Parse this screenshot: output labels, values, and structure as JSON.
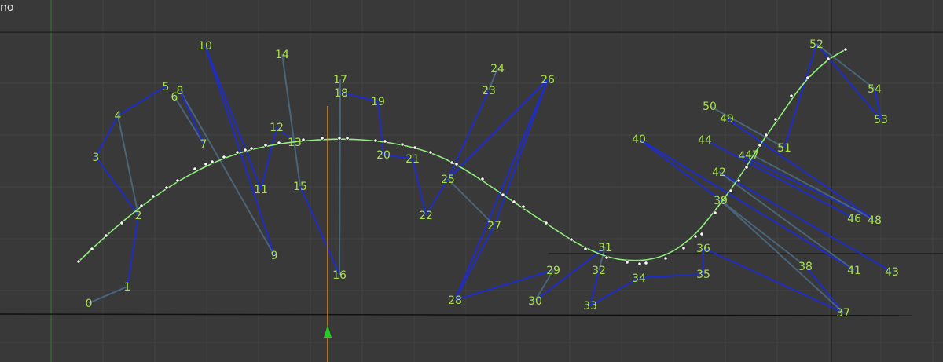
{
  "viewport": {
    "corner_text": "no",
    "colors": {
      "background": "#393939",
      "grid": "#444444",
      "axis_y": "#2e7d2e",
      "frame_line": "#111111",
      "playhead": "#ff9a1e",
      "curve": "#8ef07a",
      "handle_line": "#1f2ccc",
      "handle_line_muted": "#4a6478",
      "label": "#a8e04a",
      "arrow": "#22cc22"
    }
  },
  "points": [
    {
      "id": "0",
      "label": "0"
    },
    {
      "id": "1",
      "label": "1"
    },
    {
      "id": "2",
      "label": "2"
    },
    {
      "id": "3",
      "label": "3"
    },
    {
      "id": "4",
      "label": "4"
    },
    {
      "id": "5",
      "label": "5"
    },
    {
      "id": "6",
      "label": "6"
    },
    {
      "id": "7",
      "label": "7"
    },
    {
      "id": "8",
      "label": "8"
    },
    {
      "id": "9",
      "label": "9"
    },
    {
      "id": "10",
      "label": "10"
    },
    {
      "id": "11",
      "label": "11"
    },
    {
      "id": "12",
      "label": "12"
    },
    {
      "id": "13",
      "label": "13"
    },
    {
      "id": "14",
      "label": "14"
    },
    {
      "id": "15",
      "label": "15"
    },
    {
      "id": "16",
      "label": "16"
    },
    {
      "id": "17",
      "label": "17"
    },
    {
      "id": "18",
      "label": "18"
    },
    {
      "id": "19",
      "label": "19"
    },
    {
      "id": "20",
      "label": "20"
    },
    {
      "id": "21",
      "label": "21"
    },
    {
      "id": "22",
      "label": "22"
    },
    {
      "id": "23",
      "label": "23"
    },
    {
      "id": "24",
      "label": "24"
    },
    {
      "id": "25",
      "label": "25"
    },
    {
      "id": "26",
      "label": "26"
    },
    {
      "id": "27",
      "label": "27"
    },
    {
      "id": "28",
      "label": "28"
    },
    {
      "id": "29",
      "label": "29"
    },
    {
      "id": "30",
      "label": "30"
    },
    {
      "id": "31",
      "label": "31"
    },
    {
      "id": "32",
      "label": "32"
    },
    {
      "id": "33",
      "label": "33"
    },
    {
      "id": "34",
      "label": "34"
    },
    {
      "id": "35",
      "label": "35"
    },
    {
      "id": "36",
      "label": "36"
    },
    {
      "id": "37",
      "label": "37"
    },
    {
      "id": "38",
      "label": "38"
    },
    {
      "id": "39",
      "label": "39"
    },
    {
      "id": "40",
      "label": "40"
    },
    {
      "id": "41",
      "label": "41"
    },
    {
      "id": "42",
      "label": "42"
    },
    {
      "id": "43",
      "label": "43"
    },
    {
      "id": "44",
      "label": "44"
    },
    {
      "id": "45",
      "label": "4"
    },
    {
      "id": "46",
      "label": "46"
    },
    {
      "id": "47",
      "label": "47"
    },
    {
      "id": "48",
      "label": "48"
    },
    {
      "id": "49",
      "label": "49"
    },
    {
      "id": "50",
      "label": "50"
    },
    {
      "id": "51",
      "label": "51"
    },
    {
      "id": "52",
      "label": "52"
    },
    {
      "id": "53",
      "label": "53"
    },
    {
      "id": "54",
      "label": "54"
    }
  ],
  "segments": [
    {
      "a": "0",
      "b": "1",
      "muted": false
    },
    {
      "a": "1",
      "b": "2",
      "muted": false
    },
    {
      "a": "2",
      "b": "3",
      "muted": false
    },
    {
      "a": "3",
      "b": "4",
      "muted": false
    },
    {
      "a": "4",
      "b": "5",
      "muted": false
    },
    {
      "a": "2",
      "b": "4",
      "muted": true
    },
    {
      "a": "1",
      "b": "0",
      "muted": true
    },
    {
      "a": "6",
      "b": "7",
      "muted": true
    },
    {
      "a": "8",
      "b": "9",
      "muted": true
    },
    {
      "a": "8",
      "b": "7",
      "muted": false
    },
    {
      "a": "10",
      "b": "11",
      "muted": false
    },
    {
      "a": "10",
      "b": "9",
      "muted": false
    },
    {
      "a": "11",
      "b": "12",
      "muted": false
    },
    {
      "a": "12",
      "b": "13",
      "muted": false
    },
    {
      "a": "14",
      "b": "15",
      "muted": true
    },
    {
      "a": "15",
      "b": "16",
      "muted": false
    },
    {
      "a": "17",
      "b": "16",
      "muted": true
    },
    {
      "a": "18",
      "b": "19",
      "muted": false
    },
    {
      "a": "19",
      "b": "20",
      "muted": false
    },
    {
      "a": "20",
      "b": "21",
      "muted": false
    },
    {
      "a": "21",
      "b": "22",
      "muted": false
    },
    {
      "a": "22",
      "b": "25",
      "muted": false
    },
    {
      "a": "23",
      "b": "24",
      "muted": true
    },
    {
      "a": "23",
      "b": "25",
      "muted": false
    },
    {
      "a": "25",
      "b": "26",
      "muted": false
    },
    {
      "a": "26",
      "b": "27",
      "muted": false
    },
    {
      "a": "27",
      "b": "28",
      "muted": false
    },
    {
      "a": "26",
      "b": "28",
      "muted": false
    },
    {
      "a": "25",
      "b": "27",
      "muted": true
    },
    {
      "a": "28",
      "b": "29",
      "muted": false
    },
    {
      "a": "29",
      "b": "30",
      "muted": true
    },
    {
      "a": "30",
      "b": "31",
      "muted": false
    },
    {
      "a": "31",
      "b": "32",
      "muted": true
    },
    {
      "a": "32",
      "b": "33",
      "muted": false
    },
    {
      "a": "33",
      "b": "34",
      "muted": false
    },
    {
      "a": "34",
      "b": "35",
      "muted": false
    },
    {
      "a": "35",
      "b": "36",
      "muted": false
    },
    {
      "a": "36",
      "b": "37",
      "muted": false
    },
    {
      "a": "37",
      "b": "38",
      "muted": false
    },
    {
      "a": "37",
      "b": "39",
      "muted": true
    },
    {
      "a": "39",
      "b": "40",
      "muted": false
    },
    {
      "a": "39",
      "b": "38",
      "muted": true
    },
    {
      "a": "40",
      "b": "41",
      "muted": false
    },
    {
      "a": "42",
      "b": "43",
      "muted": false
    },
    {
      "a": "44",
      "b": "46",
      "muted": false
    },
    {
      "a": "45",
      "b": "48",
      "muted": false
    },
    {
      "a": "47",
      "b": "48",
      "muted": true
    },
    {
      "a": "49",
      "b": "48",
      "muted": false
    },
    {
      "a": "50",
      "b": "51",
      "muted": true
    },
    {
      "a": "51",
      "b": "52",
      "muted": false
    },
    {
      "a": "52",
      "b": "53",
      "muted": false
    },
    {
      "a": "53",
      "b": "54",
      "muted": false
    },
    {
      "a": "54",
      "b": "52",
      "muted": true
    },
    {
      "a": "42",
      "b": "41",
      "muted": true
    }
  ]
}
